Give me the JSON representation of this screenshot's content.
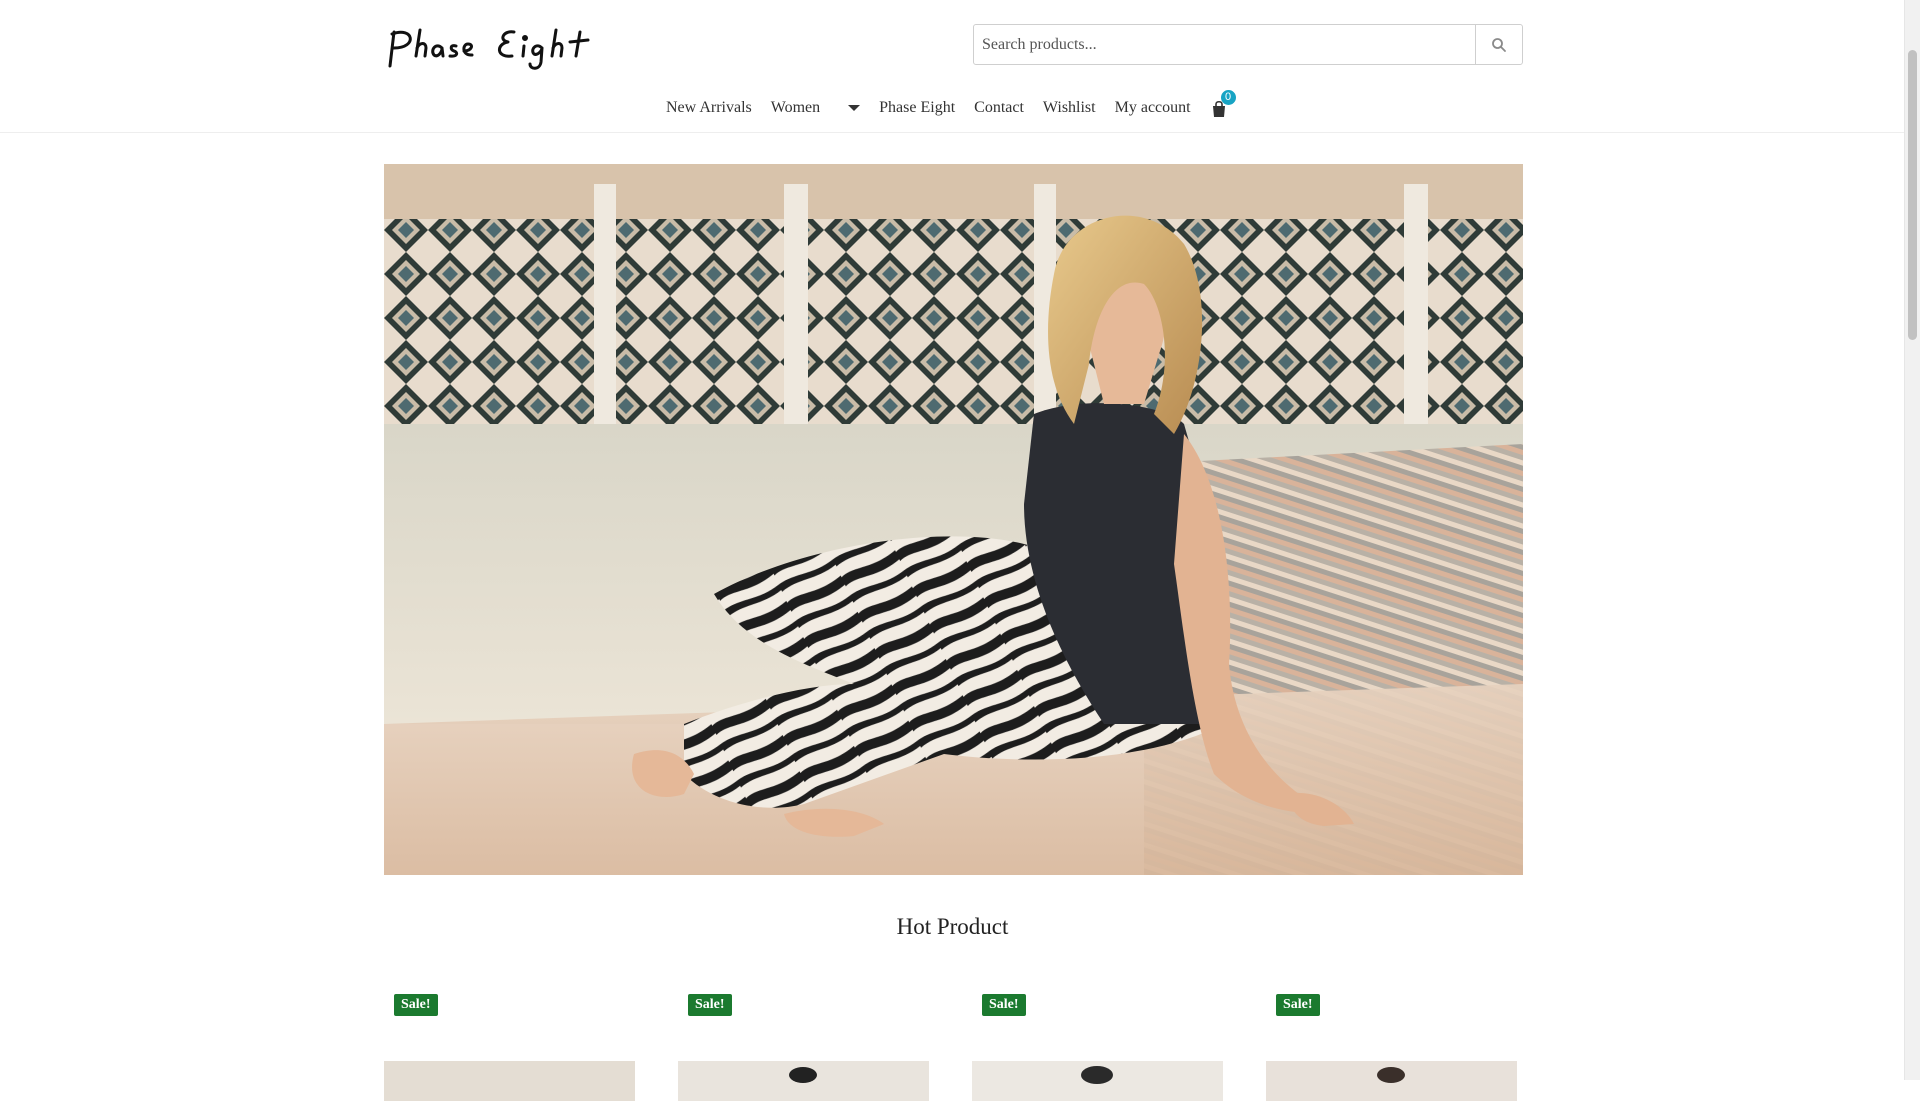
{
  "brand": {
    "logo_text": "Phase Eight"
  },
  "search": {
    "placeholder": "Search products...",
    "icon": "search-icon"
  },
  "nav": {
    "items": [
      {
        "label": "New Arrivals"
      },
      {
        "label": "Women",
        "has_dropdown": true
      },
      {
        "label": "Phase Eight"
      },
      {
        "label": "Contact"
      },
      {
        "label": "Wishlist"
      },
      {
        "label": "My account"
      }
    ],
    "cart": {
      "icon": "shopping-bag-icon",
      "count": "0"
    }
  },
  "hero": {
    "image": "model-in-zebra-print-trousers-by-pool"
  },
  "section": {
    "title": "Hot Product"
  },
  "products": [
    {
      "badge": "Sale!"
    },
    {
      "badge": "Sale!"
    },
    {
      "badge": "Sale!"
    },
    {
      "badge": "Sale!"
    }
  ],
  "colors": {
    "sale_badge": "#1b7a2f",
    "cart_badge": "#18a4c4",
    "text": "#333333"
  }
}
